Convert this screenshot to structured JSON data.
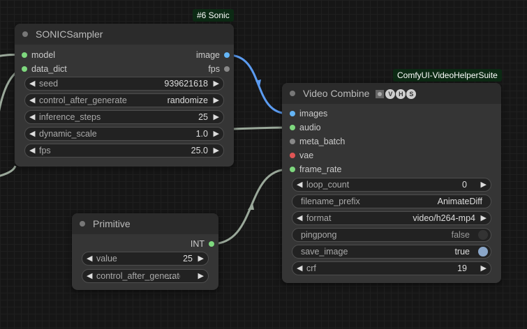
{
  "sonic_badge": "#6 Sonic",
  "vhs_badge": "ComfyUI-VideoHelperSuite",
  "colors": {
    "image_slot": "#64b5f6",
    "green_slot": "#7ed87e",
    "gray_slot": "#888888",
    "red_slot": "#e05555",
    "link_image": "#5b9bf0",
    "link_generic": "#9aa89a"
  },
  "sonic_sampler": {
    "title": "SONICSampler",
    "inputs": [
      {
        "label": "model",
        "color": "#7ed87e"
      },
      {
        "label": "data_dict",
        "color": "#7ed87e"
      }
    ],
    "outputs": [
      {
        "label": "image",
        "color": "#64b5f6"
      },
      {
        "label": "fps",
        "color": "#888888"
      }
    ],
    "widgets": [
      {
        "label": "seed",
        "value": "939621618"
      },
      {
        "label": "control_after_generate",
        "value": "randomize"
      },
      {
        "label": "inference_steps",
        "value": "25"
      },
      {
        "label": "dynamic_scale",
        "value": "1.0"
      },
      {
        "label": "fps",
        "value": "25.0"
      }
    ]
  },
  "primitive": {
    "title": "Primitive",
    "output": {
      "label": "INT",
      "color": "#7ed87e"
    },
    "widgets": [
      {
        "label": "value",
        "value": "25"
      },
      {
        "label": "control_after_generate",
        "value": "..."
      }
    ]
  },
  "video_combine": {
    "title": "Video Combine",
    "title_icons": [
      "film-icon",
      "V",
      "H",
      "S"
    ],
    "inputs": [
      {
        "label": "images",
        "color": "#64b5f6"
      },
      {
        "label": "audio",
        "color": "#7ed87e"
      },
      {
        "label": "meta_batch",
        "color": "#888888"
      },
      {
        "label": "vae",
        "color": "#e05555"
      },
      {
        "label": "frame_rate",
        "color": "#7ed87e"
      }
    ],
    "widgets": [
      {
        "label": "loop_count",
        "value": "0"
      },
      {
        "label": "filename_prefix",
        "value": "AnimateDiff"
      },
      {
        "label": "format",
        "value": "video/h264-mp4"
      },
      {
        "label": "pingpong",
        "value": "false"
      },
      {
        "label": "save_image",
        "value": "true"
      },
      {
        "label": "crf",
        "value": "19"
      }
    ]
  }
}
